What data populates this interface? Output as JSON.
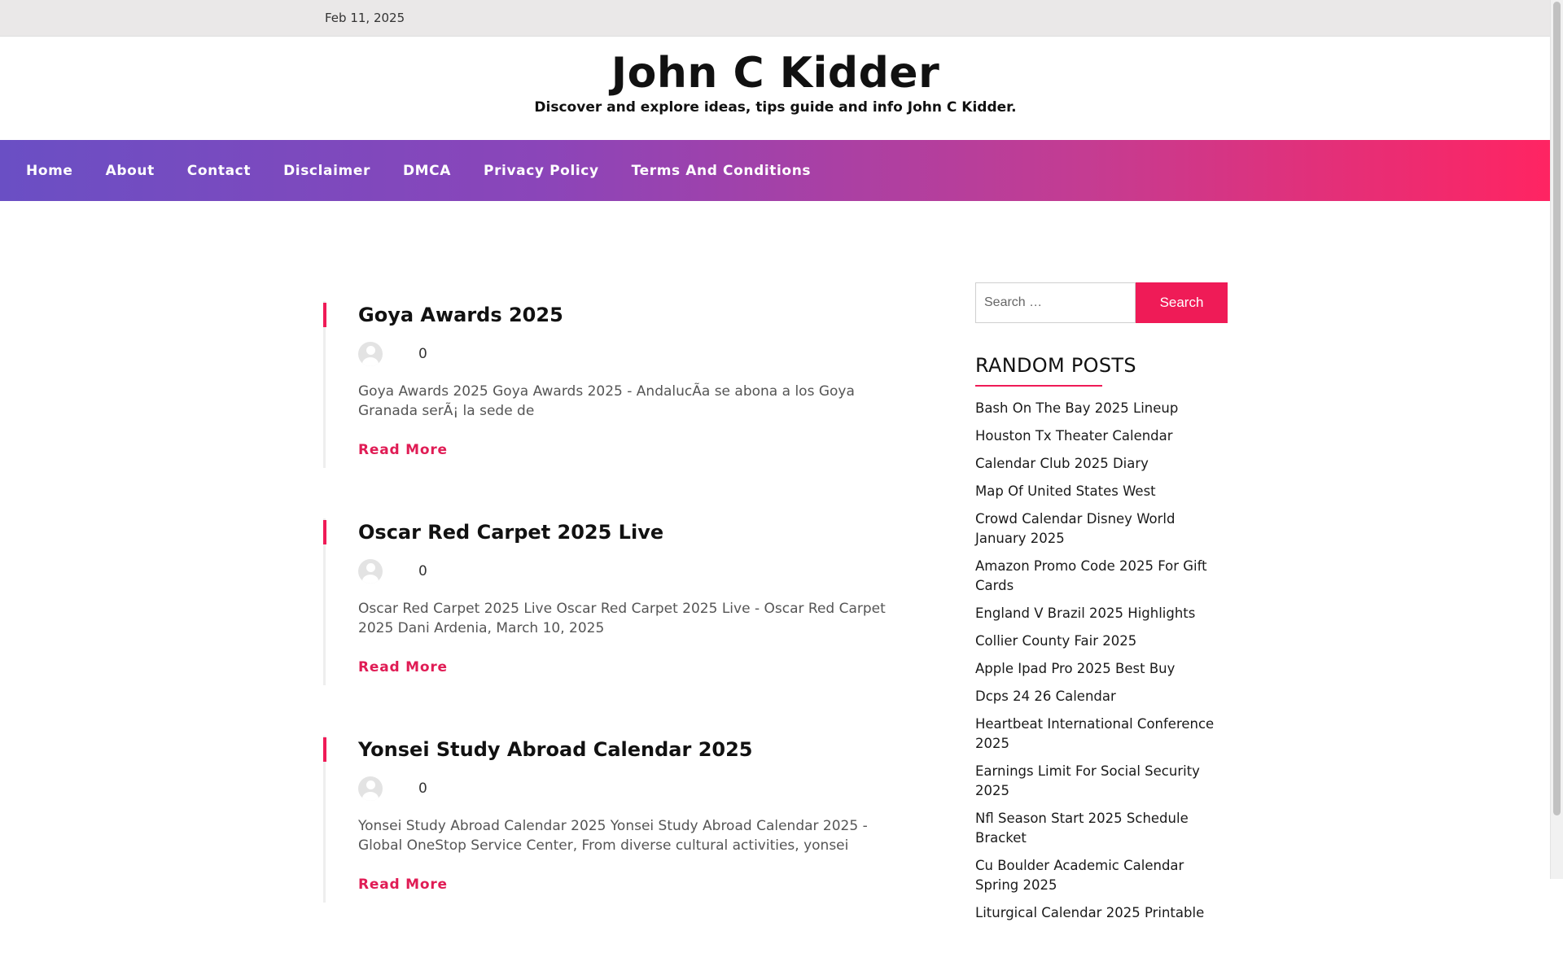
{
  "topbar": {
    "date": "Feb 11, 2025"
  },
  "header": {
    "title": "John C Kidder",
    "tagline": "Discover and explore ideas, tips guide and info John C Kidder."
  },
  "nav": {
    "items": [
      "Home",
      "About",
      "Contact",
      "Disclaimer",
      "DMCA",
      "Privacy Policy",
      "Terms And Conditions"
    ]
  },
  "posts": [
    {
      "title": "Goya Awards 2025",
      "comments": "0",
      "excerpt": "Goya Awards 2025 Goya Awards 2025 - AndalucÃ­a se abona a los Goya Granada serÃ¡ la sede de",
      "read_more": "Read More"
    },
    {
      "title": "Oscar Red Carpet 2025 Live",
      "comments": "0",
      "excerpt": "Oscar Red Carpet 2025 Live Oscar Red Carpet 2025 Live - Oscar Red Carpet 2025 Dani Ardenia, March 10, 2025",
      "read_more": "Read More"
    },
    {
      "title": "Yonsei Study Abroad Calendar 2025",
      "comments": "0",
      "excerpt": "Yonsei Study Abroad Calendar 2025 Yonsei Study Abroad Calendar 2025 - Global OneStop Service Center, From diverse cultural activities, yonsei",
      "read_more": "Read More"
    }
  ],
  "sidebar": {
    "search": {
      "placeholder": "Search …",
      "button": "Search"
    },
    "random_title": "RANDOM POSTS",
    "random_posts": [
      "Bash On The Bay 2025 Lineup",
      "Houston Tx Theater Calendar",
      "Calendar Club 2025 Diary",
      "Map Of United States West",
      "Crowd Calendar Disney World January 2025",
      "Amazon Promo Code 2025 For Gift Cards",
      "England V Brazil 2025 Highlights",
      "Collier County Fair 2025",
      "Apple Ipad Pro 2025 Best Buy",
      "Dcps 24 26 Calendar",
      "Heartbeat International Conference 2025",
      "Earnings Limit For Social Security 2025",
      "Nfl Season Start 2025 Schedule Bracket",
      "Cu Boulder Academic Calendar Spring 2025",
      "Liturgical Calendar 2025 Printable"
    ]
  },
  "colors": {
    "accent": "#ef1b57",
    "nav_start": "#6a4fc4",
    "nav_end": "#ff2462",
    "topbar": "#eae8e8"
  }
}
